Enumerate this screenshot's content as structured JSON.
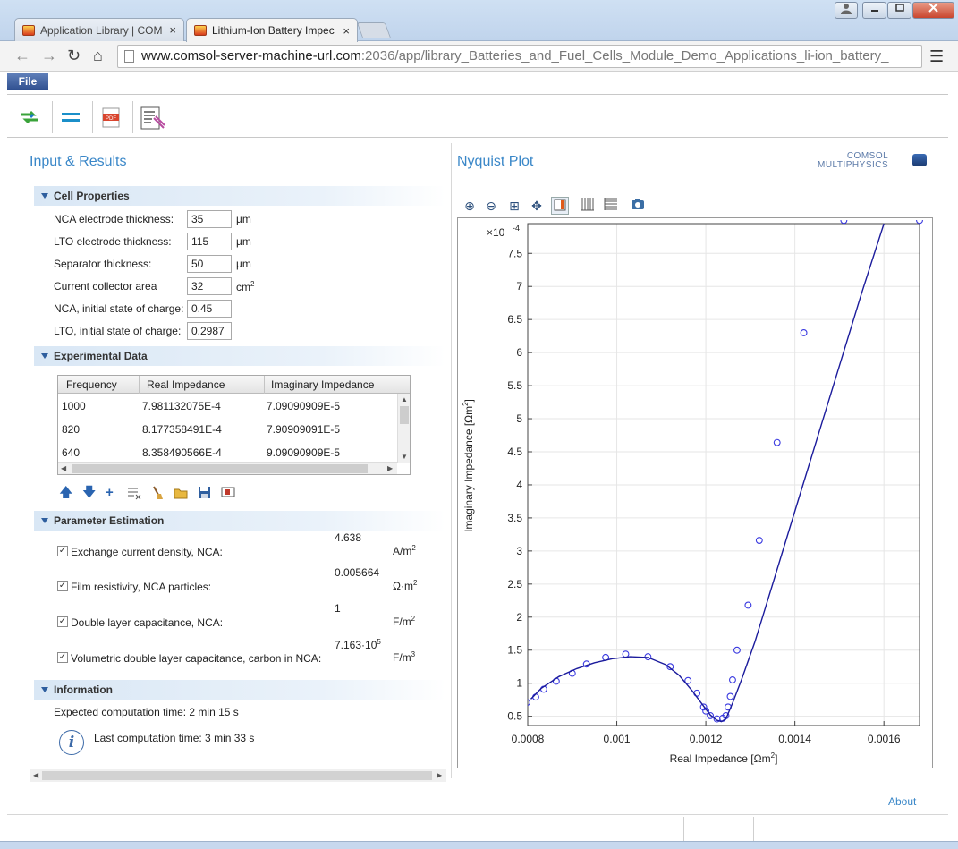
{
  "browser": {
    "tabs": [
      {
        "title": "Application Library | COM",
        "active": false
      },
      {
        "title": "Lithium-Ion Battery Impec",
        "active": true
      }
    ],
    "url_host": "www.comsol-server-machine-url.com",
    "url_rest": ":2036/app/library_Batteries_and_Fuel_Cells_Module_Demo_Applications_li-ion_battery_",
    "close_glyph": "×"
  },
  "app": {
    "menu": {
      "file": "File"
    },
    "left_title": "Input & Results",
    "right_title": "Nyquist Plot",
    "logo_line1": "COMSOL",
    "logo_line2": "MULTIPHYSICS",
    "about": "About",
    "cell_properties": {
      "heading": "Cell Properties",
      "fields": [
        {
          "label": "NCA electrode thickness:",
          "value": "35",
          "unit": "µm"
        },
        {
          "label": "LTO electrode thickness:",
          "value": "115",
          "unit": "µm"
        },
        {
          "label": "Separator thickness:",
          "value": "50",
          "unit": "µm"
        },
        {
          "label": "Current collector area",
          "value": "32",
          "unit": "cm",
          "unit_sup": "2"
        },
        {
          "label": "NCA, initial state of charge:",
          "value": "0.45",
          "unit": ""
        },
        {
          "label": "LTO, initial state of charge:",
          "value": "0.2987",
          "unit": ""
        }
      ]
    },
    "experimental_data": {
      "heading": "Experimental Data",
      "columns": [
        "Frequency",
        "Real Impedance",
        "Imaginary Impedance"
      ],
      "rows": [
        [
          "1000",
          "7.981132075E-4",
          "7.09090909E-5"
        ],
        [
          "820",
          "8.177358491E-4",
          "7.90909091E-5"
        ],
        [
          "640",
          "8.358490566E-4",
          "9.09090909E-5"
        ]
      ]
    },
    "parameter_estimation": {
      "heading": "Parameter Estimation",
      "items": [
        {
          "label": "Exchange current density, NCA:",
          "value": "4.638",
          "unit": "A/m",
          "unit_sup": "2",
          "checked": true
        },
        {
          "label": "Film resistivity, NCA particles:",
          "value": "0.005664",
          "unit": "Ω·m",
          "unit_sup": "2",
          "checked": true
        },
        {
          "label": "Double layer capacitance, NCA:",
          "value": "1",
          "unit": "F/m",
          "unit_sup": "2",
          "checked": true
        },
        {
          "label": "Volumetric double layer capacitance, carbon in NCA:",
          "value": "7.163·10",
          "value_sup": "5",
          "unit": "F/m",
          "unit_sup": "3",
          "checked": true
        }
      ]
    },
    "information": {
      "heading": "Information",
      "expected": "Expected computation time:  2 min 15 s",
      "last": "Last computation time:  3 min 33 s"
    }
  },
  "chart_data": {
    "type": "scatter",
    "xlabel": "Real Impedance [Ωm",
    "xlabel_sup": "2",
    "xlabel_end": "]",
    "ylabel": "Imaginary Impedance [Ωm",
    "ylabel_sup": "2",
    "ylabel_end": "]",
    "y_multiplier": "×10",
    "y_multiplier_exp": "-4",
    "xlim": [
      0.0008,
      0.00168
    ],
    "ylim": [
      0.36,
      7.95
    ],
    "x_ticks": [
      "0.0008",
      "0.001",
      "0.0012",
      "0.0014",
      "0.0016"
    ],
    "x_tick_values": [
      0.0008,
      0.001,
      0.0012,
      0.0014,
      0.0016
    ],
    "y_ticks": [
      "0.5",
      "1",
      "1.5",
      "2",
      "2.5",
      "3",
      "3.5",
      "4",
      "4.5",
      "5",
      "5.5",
      "6",
      "6.5",
      "7",
      "7.5"
    ],
    "y_tick_values": [
      0.5,
      1,
      1.5,
      2,
      2.5,
      3,
      3.5,
      4,
      4.5,
      5,
      5.5,
      6,
      6.5,
      7,
      7.5
    ],
    "grid": true,
    "series": [
      {
        "kind": "points",
        "color": "#3a3ae0",
        "x": [
          0.000798,
          0.000818,
          0.000836,
          0.000864,
          0.0009,
          0.000932,
          0.000975,
          0.00102,
          0.00107,
          0.00112,
          0.00116,
          0.00118,
          0.001195,
          0.0012,
          0.00121,
          0.001225,
          0.001238,
          0.001245,
          0.00125,
          0.001255,
          0.00126,
          0.00127,
          0.001295,
          0.00132,
          0.00136,
          0.00142,
          0.00151,
          0.00168
        ],
        "y": [
          0.709,
          0.791,
          0.909,
          1.03,
          1.15,
          1.29,
          1.39,
          1.44,
          1.4,
          1.25,
          1.04,
          0.85,
          0.64,
          0.58,
          0.51,
          0.46,
          0.47,
          0.51,
          0.64,
          0.8,
          1.05,
          1.5,
          2.18,
          3.16,
          4.64,
          6.3,
          8.0,
          8.0
        ]
      },
      {
        "kind": "line",
        "color": "#1b1b9c",
        "x": [
          0.000807,
          0.00083,
          0.00087,
          0.00091,
          0.00095,
          0.00099,
          0.00103,
          0.00107,
          0.00111,
          0.00114,
          0.00117,
          0.00119,
          0.00121,
          0.001225,
          0.001235,
          0.001245,
          0.00126,
          0.00128,
          0.00131,
          0.00135,
          0.0014,
          0.00145,
          0.0015,
          0.00155,
          0.0016
        ],
        "y": [
          0.76,
          0.92,
          1.1,
          1.22,
          1.31,
          1.37,
          1.4,
          1.39,
          1.28,
          1.12,
          0.88,
          0.7,
          0.52,
          0.44,
          0.42,
          0.46,
          0.7,
          1.05,
          1.62,
          2.5,
          3.6,
          4.7,
          5.8,
          6.9,
          7.95
        ]
      }
    ]
  }
}
